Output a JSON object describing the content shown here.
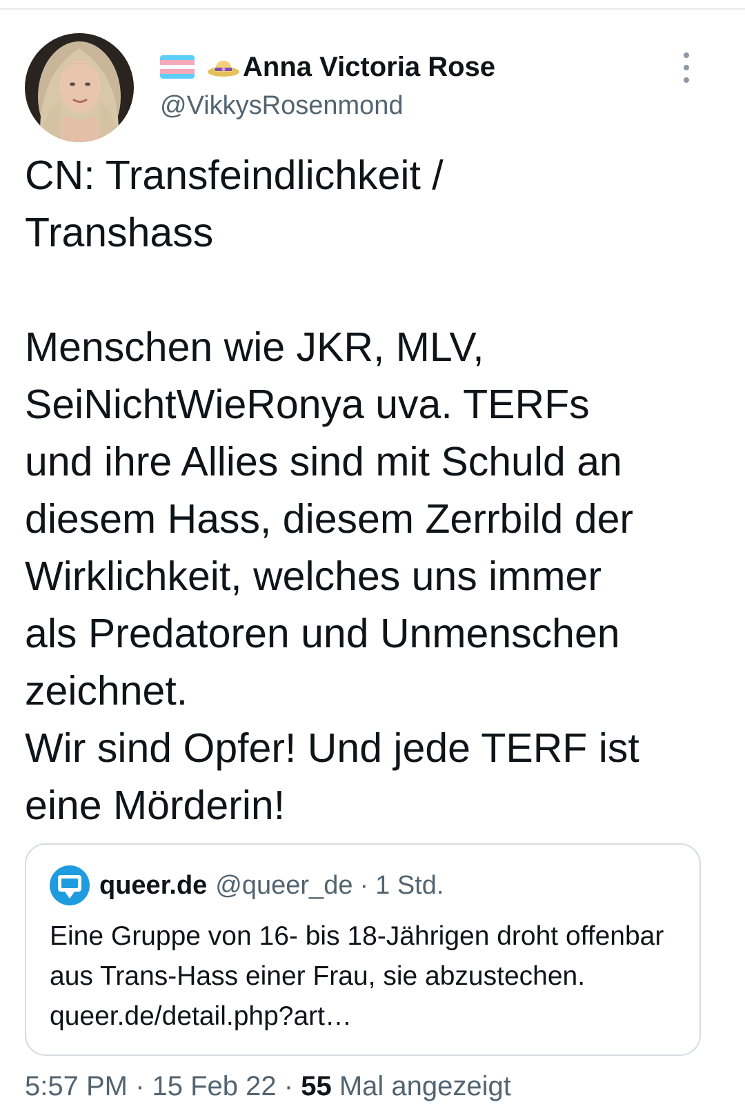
{
  "author": {
    "display_name": "Anna Victoria Rose",
    "handle": "@VikkysRosenmond",
    "badges": [
      "transgender-flag-icon",
      "hat-icon"
    ]
  },
  "tweet": {
    "text": "CN: Transfeindlichkeit /\nTranshass\n\nMenschen wie JKR, MLV,\nSeiNichtWieRonya uva. TERFs\nund ihre Allies sind mit Schuld an\ndiesem Hass, diesem Zerrbild der\nWirklichkeit, welches uns immer\nals Predatoren und Unmenschen\nzeichnet.\nWir sind Opfer! Und jede TERF ist\neine Mörderin!"
  },
  "quote": {
    "name": "queer.de",
    "handle": "@queer_de",
    "separator": "·",
    "time": "1 Std.",
    "text": "Eine Gruppe von 16- bis 18-Jährigen droht offenbar aus Trans-Hass einer Frau, sie abzustechen. queer.de/detail.php?art…",
    "avatar_icon": "queer-de-logo-icon"
  },
  "meta": {
    "time": "5:57 PM · 15 Feb 22 ·",
    "count": "55",
    "source": "Mal angezeigt"
  },
  "colors": {
    "text": "#0f1419",
    "secondary": "#536471",
    "border": "#d6dbdf",
    "flag_blue": "#5bcefa",
    "flag_pink": "#f5a9b8",
    "queer_blue": "#1f9be0"
  }
}
